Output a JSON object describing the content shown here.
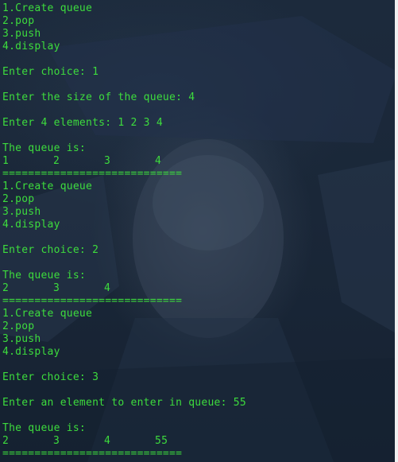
{
  "colors": {
    "background": "#1a2637",
    "text": "#3ddc3d"
  },
  "lines": [
    "1.Create queue",
    "2.pop",
    "3.push",
    "4.display",
    "",
    "Enter choice: 1",
    "",
    "Enter the size of the queue: 4",
    "",
    "Enter 4 elements: 1 2 3 4",
    "",
    "The queue is:",
    [
      "1",
      "2",
      "3",
      "4"
    ],
    "============================",
    "1.Create queue",
    "2.pop",
    "3.push",
    "4.display",
    "",
    "Enter choice: 2",
    "",
    "The queue is:",
    [
      "2",
      "3",
      "4"
    ],
    "============================",
    "1.Create queue",
    "2.pop",
    "3.push",
    "4.display",
    "",
    "Enter choice: 3",
    "",
    "Enter an element to enter in queue: 55",
    "",
    "The queue is:",
    [
      "2",
      "3",
      "4",
      "55"
    ],
    "============================"
  ]
}
